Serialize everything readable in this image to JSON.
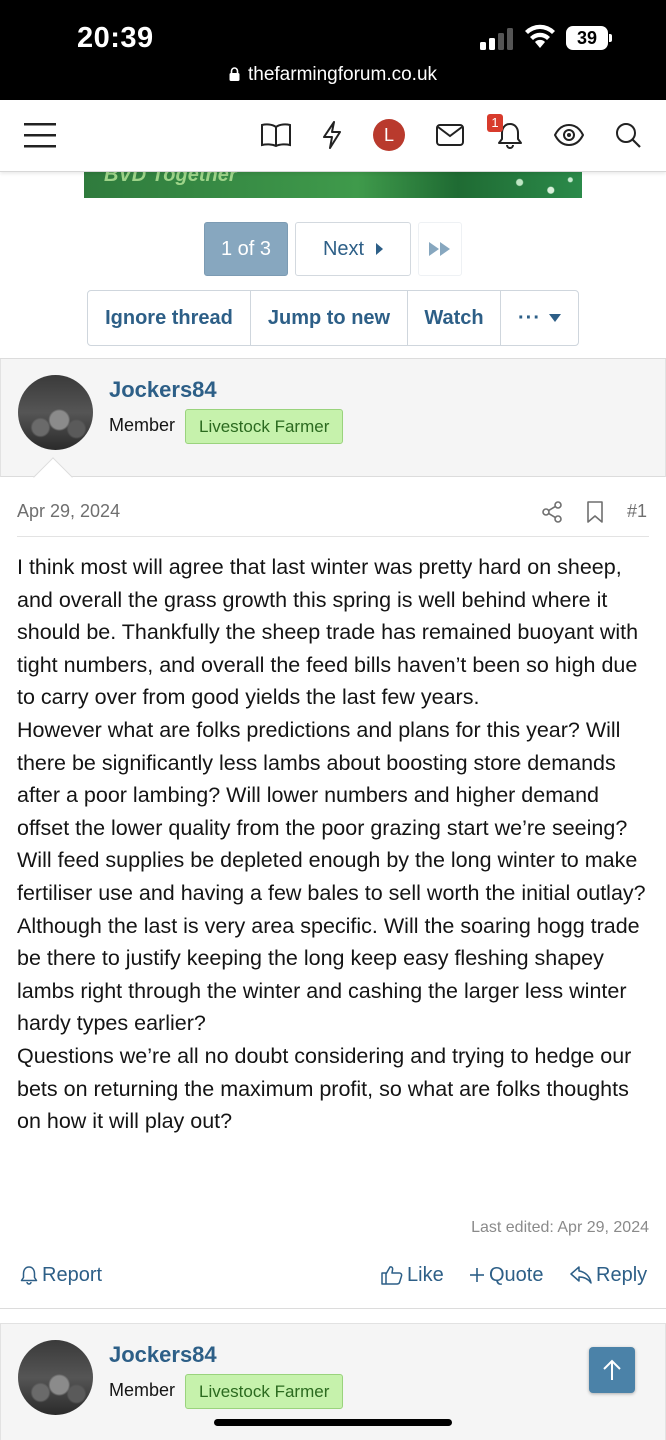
{
  "status_bar": {
    "time": "20:39",
    "battery": "39",
    "url": "thefarmingforum.co.uk"
  },
  "nav": {
    "icons": [
      "menu-icon",
      "book-icon",
      "lightning-icon",
      "avatar",
      "mail-icon",
      "bell-icon",
      "eye-icon",
      "search-icon"
    ],
    "avatar_letter": "L",
    "notification_count": "1"
  },
  "banner": {
    "text": "BVD Together"
  },
  "pagination": {
    "current": "1 of 3",
    "next": "Next"
  },
  "thread_actions": {
    "ignore": "Ignore thread",
    "jump": "Jump to new",
    "watch": "Watch",
    "more": "···"
  },
  "post": {
    "username": "Jockers84",
    "role": "Member",
    "badge": "Livestock Farmer",
    "date": "Apr 29, 2024",
    "number": "#1",
    "body": [
      "I think most will agree that last winter was pretty hard on sheep, and overall the grass growth this spring is well behind where it should be. Thankfully the sheep trade has remained buoyant with tight numbers, and overall the feed bills haven’t been so high due to carry over from good yields the last few years.",
      "However what are folks predictions and plans for this year? Will there be significantly less lambs about boosting store demands after a poor lambing? Will lower numbers and higher demand offset the lower quality from the poor grazing start we’re seeing? Will feed supplies be depleted enough by the long winter to make fertiliser use and having a few bales to sell worth the initial outlay? Although the last is very area specific. Will the soaring hogg trade be there to justify keeping the long keep easy fleshing shapey lambs right through the winter and cashing the larger less winter hardy types earlier?",
      "Questions we’re all no doubt considering and trying to hedge our bets on returning the maximum profit, so what are folks thoughts on how it will play out?"
    ],
    "last_edited": "Last edited: Apr 29, 2024",
    "actions": {
      "report": "Report",
      "like": "Like",
      "quote": "Quote",
      "reply": "Reply"
    }
  },
  "post2": {
    "username": "Jockers84",
    "role": "Member",
    "badge": "Livestock Farmer"
  }
}
